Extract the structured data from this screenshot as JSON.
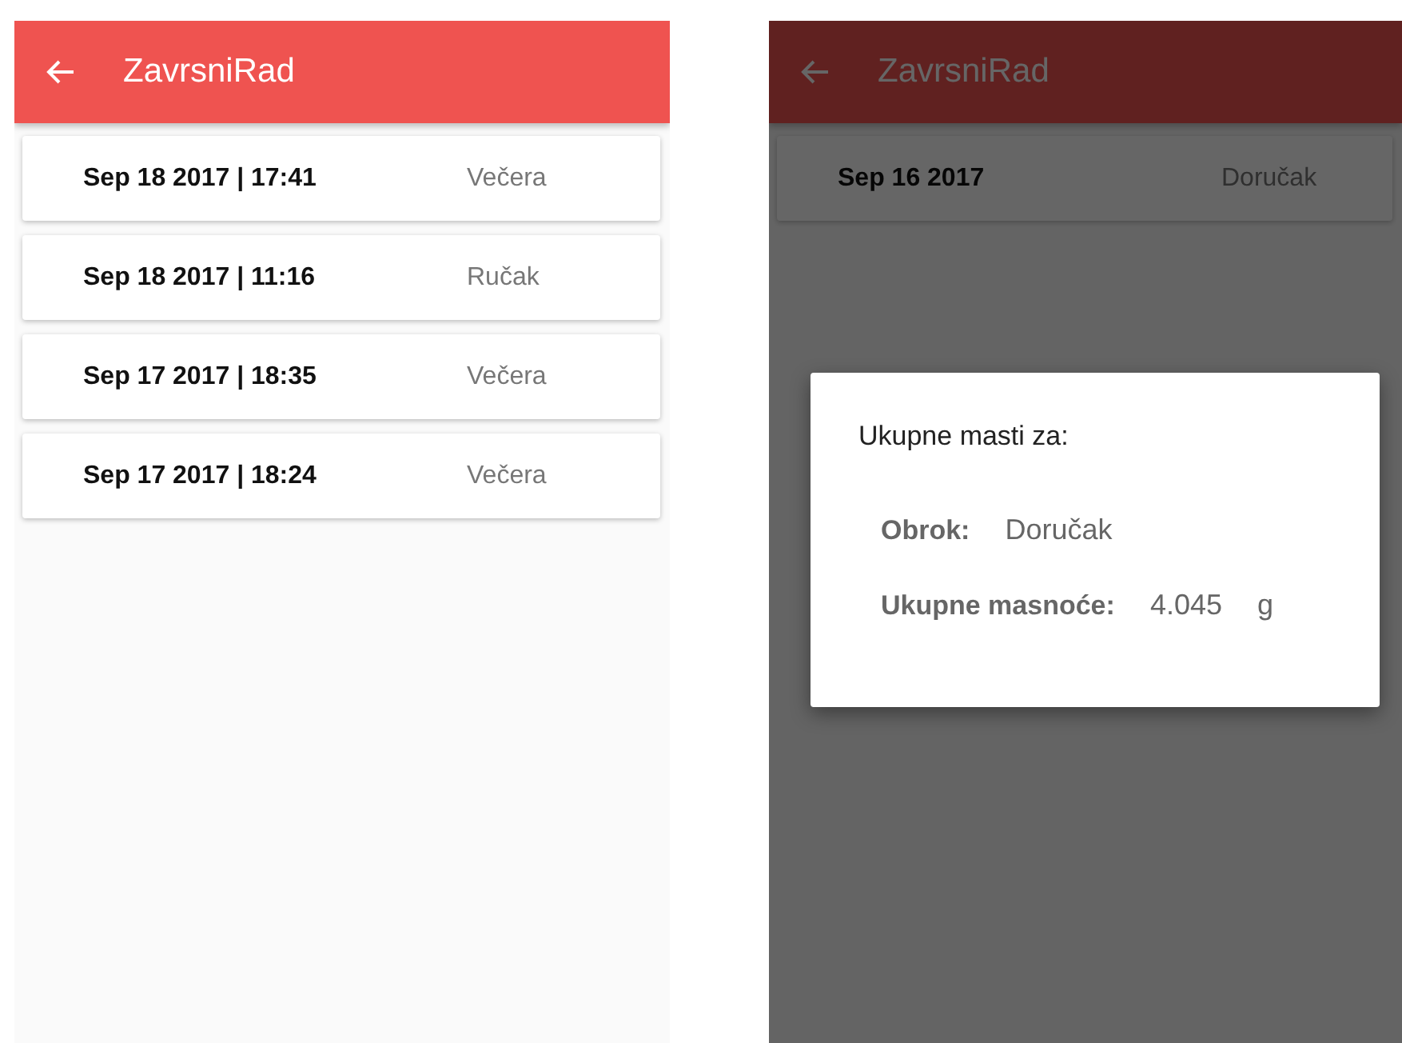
{
  "screens": [
    {
      "app_bar": {
        "title": "ZavrsniRad"
      },
      "meals": [
        {
          "date": "Sep 18 2017 | 17:41",
          "meal": "Večera"
        },
        {
          "date": "Sep 18 2017 | 11:16",
          "meal": "Ručak"
        },
        {
          "date": "Sep 17 2017 | 18:35",
          "meal": "Večera"
        },
        {
          "date": "Sep 17 2017 | 18:24",
          "meal": "Večera"
        }
      ]
    },
    {
      "app_bar": {
        "title": "ZavrsniRad"
      },
      "meals": [
        {
          "date": "Sep 16 2017",
          "meal": "Doručak"
        }
      ],
      "dialog": {
        "title": "Ukupne masti za:",
        "rows": [
          {
            "label": "Obrok:",
            "value": "Doručak"
          },
          {
            "label": "Ukupne masnoće:",
            "value": "4.045",
            "unit": "g"
          }
        ]
      }
    }
  ]
}
